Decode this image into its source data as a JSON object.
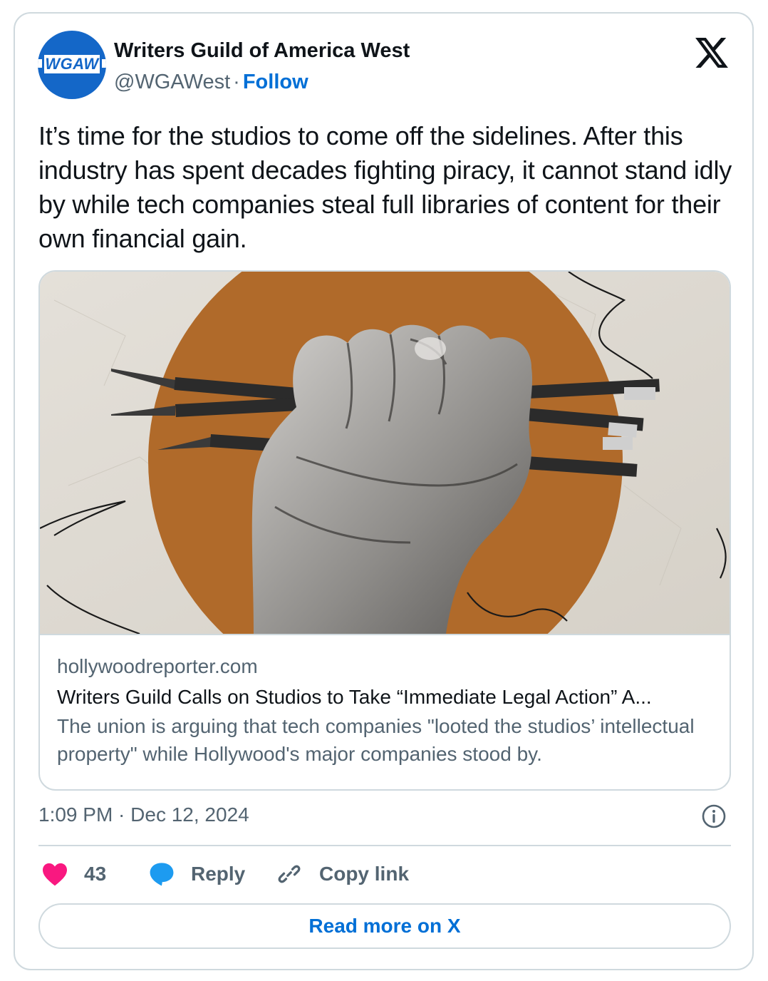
{
  "author": {
    "avatar_text": "WGAW",
    "name": "Writers Guild of America West",
    "handle": "@WGAWest",
    "separator": "·",
    "follow_label": "Follow"
  },
  "tweet": {
    "text": "It’s time for the studios to come off the sidelines. After this industry has spent decades fighting piracy, it cannot stand idly by while tech companies steal full libraries of content for their own financial gain."
  },
  "link_card": {
    "domain": "hollywoodreporter.com",
    "headline": "Writers Guild Calls on Studios to Take “Immediate Legal Action” A...",
    "description": "The union is arguing that tech companies \"looted the studios’ intellectual property\" while Hollywood's major companies stood by."
  },
  "timestamp": "1:09 PM · Dec 12, 2024",
  "actions": {
    "like_count": "43",
    "reply_label": "Reply",
    "copy_label": "Copy link"
  },
  "read_more_label": "Read more on X",
  "colors": {
    "accent": "#006fd6",
    "like": "#f91880",
    "reply": "#1d9bf0",
    "avatar_bg": "#1467c8",
    "image_circle": "#b06a2a"
  }
}
